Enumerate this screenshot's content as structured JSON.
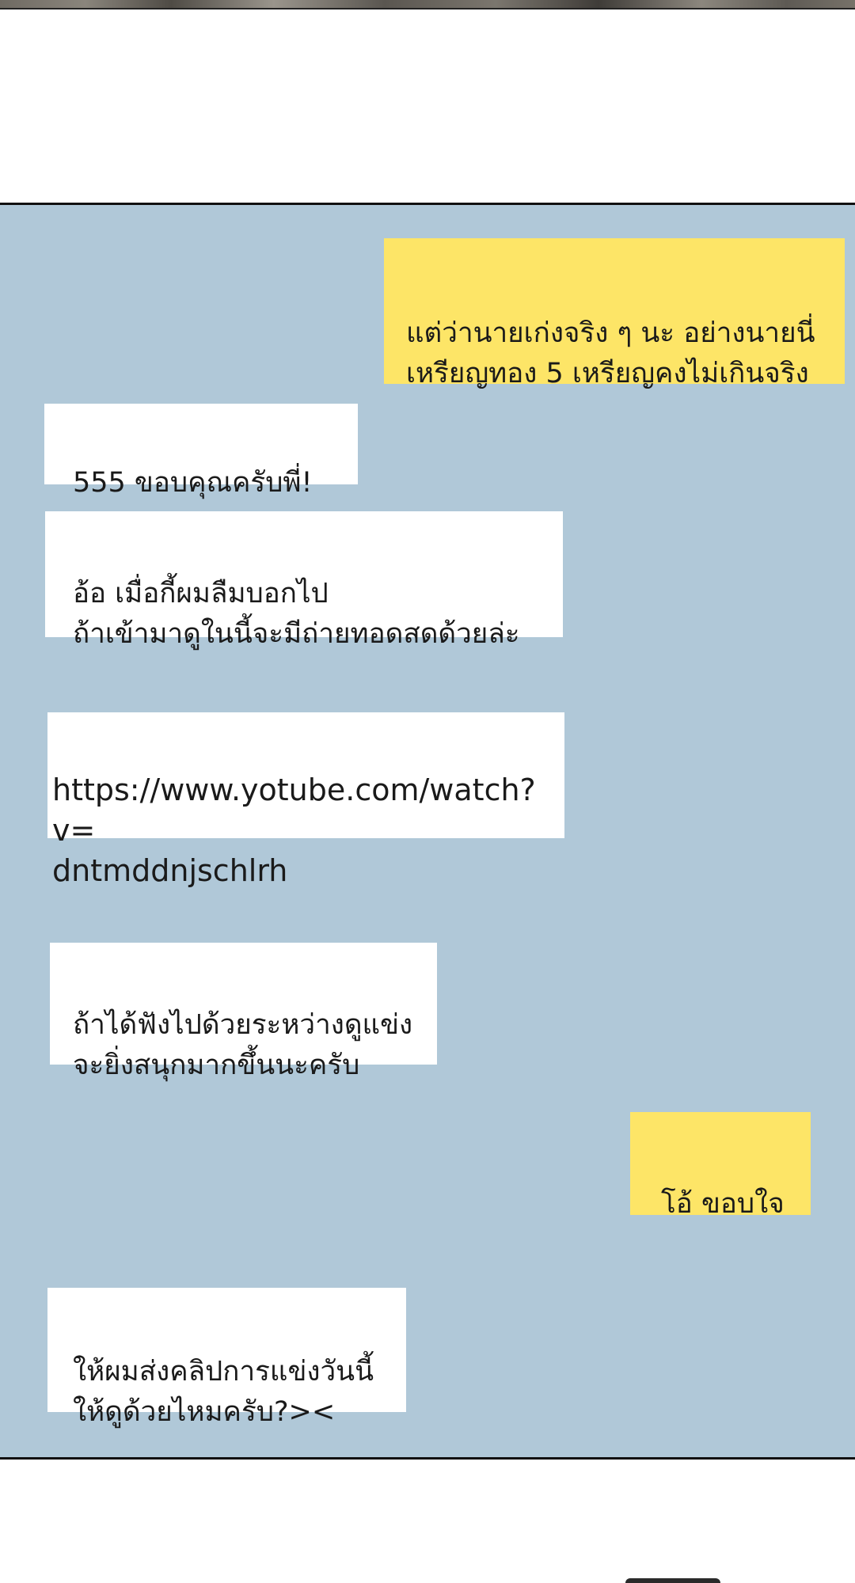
{
  "messages": [
    {
      "side": "sent",
      "text": "แต่ว่านายเก่งจริง ๆ นะ อย่างนายนี่\nเหรียญทอง 5 เหรียญคงไม่เกินจริง"
    },
    {
      "side": "received",
      "text": "555 ขอบคุณครับพี่!"
    },
    {
      "side": "received",
      "text": "อ้อ เมื่อกี้ผมลืมบอกไป\nถ้าเข้ามาดูในนี้จะมีถ่ายทอดสดด้วยล่ะ"
    },
    {
      "side": "received",
      "text": "https://www.yotube.com/watch?v=\ndntmddnjschlrh"
    },
    {
      "side": "received",
      "text": "ถ้าได้ฟังไปด้วยระหว่างดูแข่ง\nจะยิ่งสนุกมากขึ้นนะครับ"
    },
    {
      "side": "sent",
      "text": "โอ้ ขอบใจ"
    },
    {
      "side": "received",
      "text": "ให้ผมส่งคลิปการแข่งวันนี้\nให้ดูด้วยไหมครับ?><"
    }
  ],
  "colors": {
    "chat_background": "#b0c8d8",
    "sent_bubble": "#fde567",
    "received_bubble": "#ffffff"
  }
}
